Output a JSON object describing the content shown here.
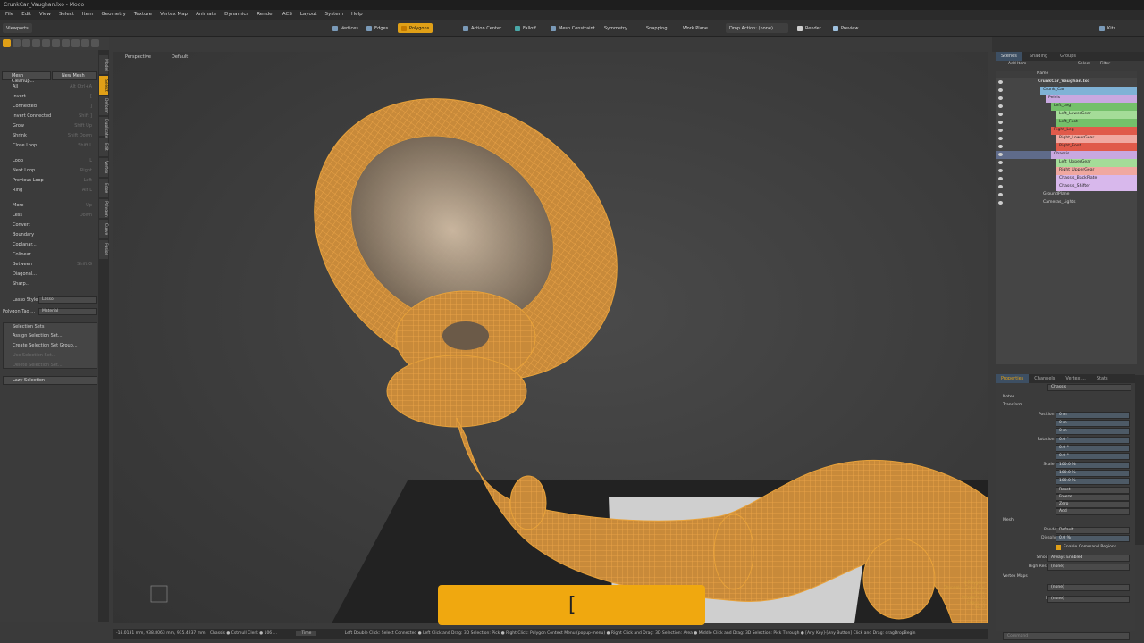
{
  "app": {
    "title": "CrunkCar_Vaughan.lxo - Modo"
  },
  "menu": [
    "File",
    "Edit",
    "View",
    "Select",
    "Item",
    "Geometry",
    "Texture",
    "Vertex Map",
    "Animate",
    "Dynamics",
    "Render",
    "ACS",
    "Layout",
    "System",
    "Help"
  ],
  "toolbar": {
    "viewports": "Viewports",
    "vertices": "Vertices",
    "edges": "Edges",
    "polygons": "Polygons",
    "action_center": "Action Center",
    "falloff": "Falloff",
    "mesh_constraint": "Mesh Constraint",
    "symmetry": "Symmetry",
    "snapping": "Snapping",
    "work_plane": "Work Plane",
    "drop_action": "Drop Action: (none)",
    "render": "Render",
    "preview": "Preview",
    "kits": "Kits"
  },
  "left_panel": {
    "mesh_cleanup": "Mesh Cleanup...",
    "new_mesh": "New Mesh",
    "group1": [
      {
        "label": "All",
        "shortcut": "Alt Ctrl+A"
      },
      {
        "label": "Invert",
        "shortcut": "["
      },
      {
        "label": "Connected",
        "shortcut": "]"
      },
      {
        "label": "Invert Connected",
        "shortcut": "Shift ]"
      },
      {
        "label": "Grow",
        "shortcut": "Shift Up"
      },
      {
        "label": "Shrink",
        "shortcut": "Shift Down"
      },
      {
        "label": "Close Loop",
        "shortcut": "Shift L"
      }
    ],
    "group2": [
      {
        "label": "Loop",
        "shortcut": "L"
      },
      {
        "label": "Next Loop",
        "shortcut": "Right"
      },
      {
        "label": "Previous Loop",
        "shortcut": "Left"
      },
      {
        "label": "Ring",
        "shortcut": "Alt L"
      }
    ],
    "group3": [
      {
        "label": "More",
        "shortcut": "Up"
      },
      {
        "label": "Less",
        "shortcut": "Down"
      },
      {
        "label": "Convert",
        "shortcut": ""
      },
      {
        "label": "Boundary",
        "shortcut": ""
      },
      {
        "label": "Coplanar...",
        "shortcut": ""
      },
      {
        "label": "Colinear...",
        "shortcut": ""
      },
      {
        "label": "Between",
        "shortcut": "Shift G"
      },
      {
        "label": "Diagonal...",
        "shortcut": ""
      },
      {
        "label": "Sharp...",
        "shortcut": ""
      }
    ],
    "lasso_style_label": "Lasso Style",
    "lasso_style_value": "Lasso",
    "polygon_tag_label": "Polygon Tag ...",
    "polygon_tag_value": "Material",
    "selection_sets_header": "Selection Sets",
    "selection_sets": [
      {
        "label": "Assign Selection Set...",
        "enabled": true
      },
      {
        "label": "Create Selection Set Group...",
        "enabled": true
      },
      {
        "label": "Use Selection Set...",
        "enabled": false
      },
      {
        "label": "Delete Selection Set...",
        "enabled": false
      }
    ],
    "lazy_selection": "Lazy Selection",
    "vtabs": [
      "Model",
      "Select",
      "Deform",
      "Duplicate",
      "Edit",
      "Vertex",
      "Edge",
      "Polygon",
      "Curve",
      "Fusion"
    ]
  },
  "viewport": {
    "view_mode": "Perspective",
    "style": "Default",
    "command_popup_text": "[",
    "stats": [
      "0 Polygons",
      "Channels : Crunk_Car",
      "0 Items",
      "Polygons : 0",
      "Edges : 0",
      "GL: 0"
    ]
  },
  "status_bar": {
    "coords": "-18.0131 mm, 938.8063 mm, 915.4237 mm",
    "item_info": "Chassis  ● Cstmull Clerk ● 106 ...",
    "time": "Time",
    "hints": "Left Double Click: Select Connected ● Left Click and Drag: 3D Selection: Pick ● Right Click: Polygon Context Menu (popup-menu) ● Right Click and Drag: 3D Selection: Area ● Middle Click and Drag: 3D Selection: Pick Through ● [Any Key]-[Any Button] Click and Drag: dragDropBegin"
  },
  "scene": {
    "tabs": [
      "Scenes",
      "Shading",
      "Groups"
    ],
    "add_item": "Add Item",
    "select": "Select",
    "filter": "Filter",
    "column_name": "Name",
    "items": [
      {
        "name": "CrunkCar_Vaughan.lxo",
        "indent": 0,
        "color": "#454545",
        "bold": true
      },
      {
        "name": "Crunk_Car",
        "indent": 1,
        "color": "#7fb2d6"
      },
      {
        "name": "Pelvis",
        "indent": 2,
        "color": "#c8a8e0"
      },
      {
        "name": "Left_Leg",
        "indent": 3,
        "color": "#74c06a"
      },
      {
        "name": "Left_LowerGear",
        "indent": 4,
        "color": "#a4dc98"
      },
      {
        "name": "Left_Foot",
        "indent": 4,
        "color": "#74c06a"
      },
      {
        "name": "Right_Leg",
        "indent": 3,
        "color": "#e05a4a"
      },
      {
        "name": "Right_LowerGear",
        "indent": 4,
        "color": "#f0a8a0"
      },
      {
        "name": "Right_Foot",
        "indent": 4,
        "color": "#e05a4a"
      },
      {
        "name": "Chassis",
        "indent": 3,
        "color": "#c8a8e0",
        "selected": true
      },
      {
        "name": "Left_UpperGear",
        "indent": 4,
        "color": "#a4dc98"
      },
      {
        "name": "Right_UpperGear",
        "indent": 4,
        "color": "#f0a8a0"
      },
      {
        "name": "Chassis_BackPlate",
        "indent": 4,
        "color": "#d8b8ec"
      },
      {
        "name": "Chassis_Shifter",
        "indent": 4,
        "color": "#d8b8ec"
      },
      {
        "name": "GroundPlane",
        "indent": 1,
        "color": "#454545"
      },
      {
        "name": "Cameras_Lights",
        "indent": 1,
        "color": "#454545"
      }
    ]
  },
  "properties": {
    "tabs": [
      "Properties",
      "Channels",
      "Vertex ...",
      "Stats"
    ],
    "name_label": "Name",
    "name_value": "Chassis",
    "notes": "Notes",
    "transform": "Transform",
    "position_label": "Position X",
    "rotation_label": "Rotation X",
    "scale_label": "Scale X",
    "y": "Y",
    "z": "Z",
    "position": [
      "0 m",
      "0 m",
      "0 m"
    ],
    "rotation": [
      "0.0 °",
      "0.0 °",
      "0.0 °"
    ],
    "scale": [
      "100.0 %",
      "100.0 %",
      "100.0 %"
    ],
    "actions": [
      "Reset",
      "Freeze",
      "Zero",
      "Add"
    ],
    "mesh": "Mesh",
    "render_label": "Render",
    "render_value": "Default",
    "dissolve_label": "Dissolve",
    "dissolve_value": "0.0 %",
    "enable_command_regions": "Enable Command Regions",
    "smoothing_label": "Smoothing",
    "smoothing_value": "Always Enabled",
    "high_res_label": "High Res Mesh",
    "high_res_value": "(none)",
    "vertex_maps": "Vertex Maps",
    "uv_label": "UV",
    "uv_value": "(none)",
    "morph_label": "Morph",
    "morph_value": "(none)",
    "command_placeholder": "Command"
  },
  "colors": {
    "accent": "#e0a017",
    "wire": "#e8a23a",
    "selected_row": "#5f6b8a"
  }
}
